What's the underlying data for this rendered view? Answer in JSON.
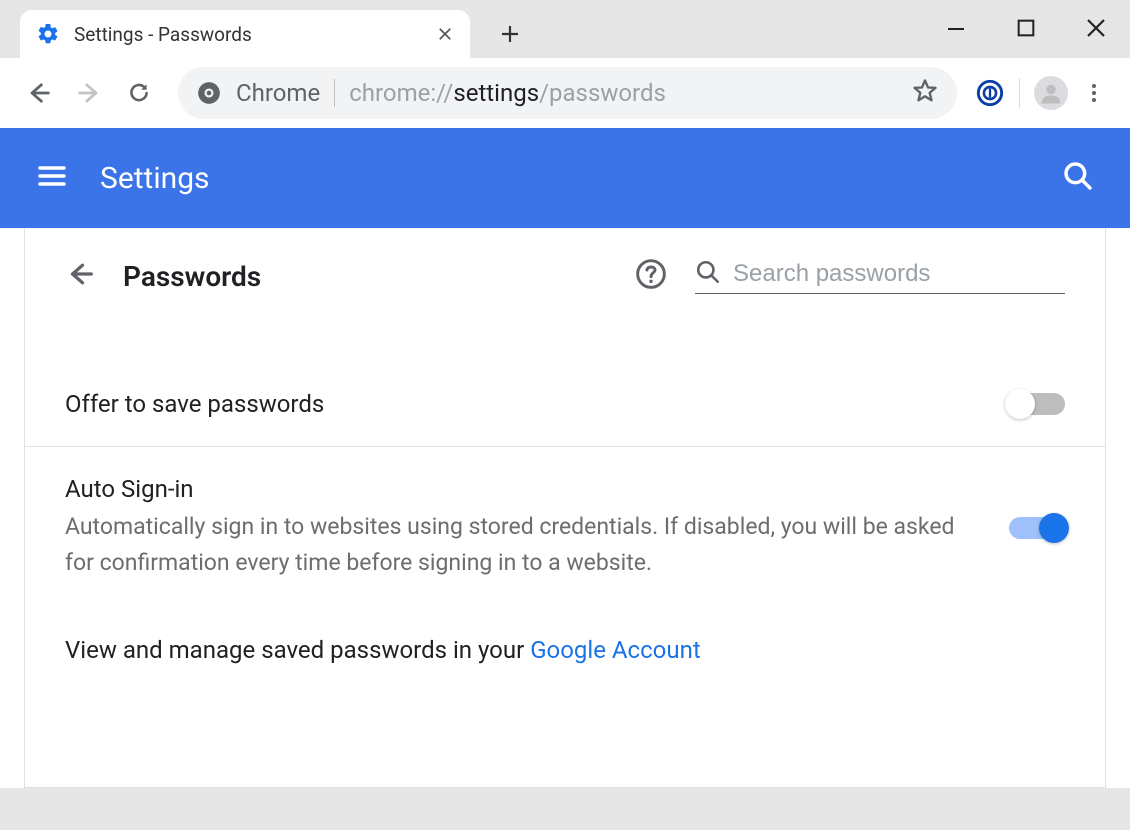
{
  "window": {
    "tab_title": "Settings - Passwords"
  },
  "addressbar": {
    "scheme_label": "Chrome",
    "path_prefix": "chrome://",
    "path_dark": "settings",
    "path_rest": "/passwords"
  },
  "header": {
    "title": "Settings"
  },
  "page": {
    "title": "Passwords",
    "search_placeholder": "Search passwords",
    "offer_save_label": "Offer to save passwords",
    "auto_signin_label": "Auto Sign-in",
    "auto_signin_desc": "Automatically sign in to websites using stored credentials. If disabled, you will be asked for confirmation every time before signing in to a website.",
    "manage_text": "View and manage saved passwords in your ",
    "manage_link_text": "Google Account",
    "offer_save_on": false,
    "auto_signin_on": true
  }
}
